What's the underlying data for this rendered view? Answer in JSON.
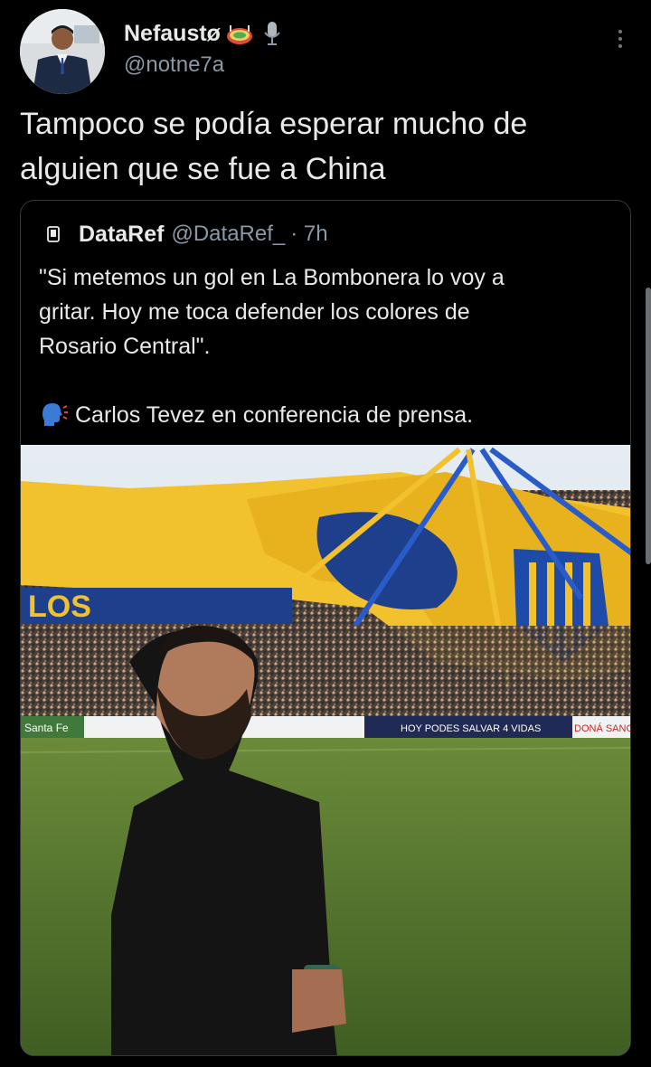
{
  "tweet": {
    "display_name": "Nefaustø",
    "handle": "@notne7a",
    "text_line1": "Tampoco se podía esperar mucho de",
    "text_line2": "alguien que se fue a China"
  },
  "quoted": {
    "name": "DataRef",
    "handle": "@DataRef_",
    "time": "· 7h",
    "line1": "\"Si metemos un gol en La Bombonera lo voy a",
    "line2": "gritar. Hoy me toca defender los colores de",
    "line3": "Rosario Central\".",
    "attribution": "Carlos Tevez en conferencia de prensa."
  },
  "photo": {
    "banner_left": "LOS",
    "ad_text": "HOY PODES SALVAR 4 VIDAS",
    "ad_right": "DONÁ SANG",
    "ad_left": "Santa Fe"
  },
  "colors": {
    "background": "#000000",
    "text": "#e7e9ea",
    "secondary": "#8b98a5",
    "border": "#33383d",
    "central_yellow": "#f2c12e",
    "central_blue": "#1e4aa8"
  },
  "icons": [
    "stadium-emoji-icon",
    "microphone-emoji-icon",
    "more-icon",
    "quoted-avatar-icon",
    "speaking-head-icon"
  ]
}
